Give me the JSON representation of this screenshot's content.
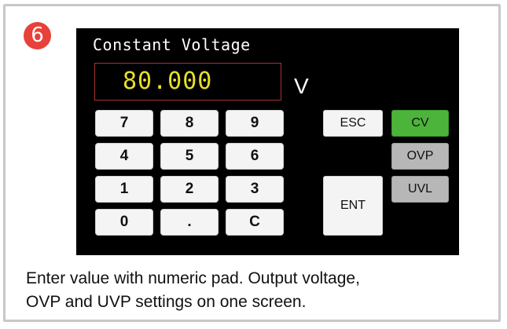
{
  "step_number": "6",
  "screen": {
    "title": "Constant Voltage",
    "display_value": "80.000",
    "unit": "V"
  },
  "keypad": {
    "keys": [
      "7",
      "8",
      "9",
      "4",
      "5",
      "6",
      "1",
      "2",
      "3",
      "0",
      ".",
      "C"
    ]
  },
  "function_keys": {
    "esc": "ESC",
    "ent": "ENT",
    "cv": "CV",
    "ovp": "OVP",
    "uvl": "UVL"
  },
  "colors": {
    "badge": "#e8413a",
    "display_text": "#e6df2b",
    "cv_active": "#4cb43b",
    "inactive_mode": "#b7b7b7"
  },
  "caption": {
    "line1": "Enter value with numeric pad. Output voltage,",
    "line2": "OVP and UVP settings on one screen."
  }
}
